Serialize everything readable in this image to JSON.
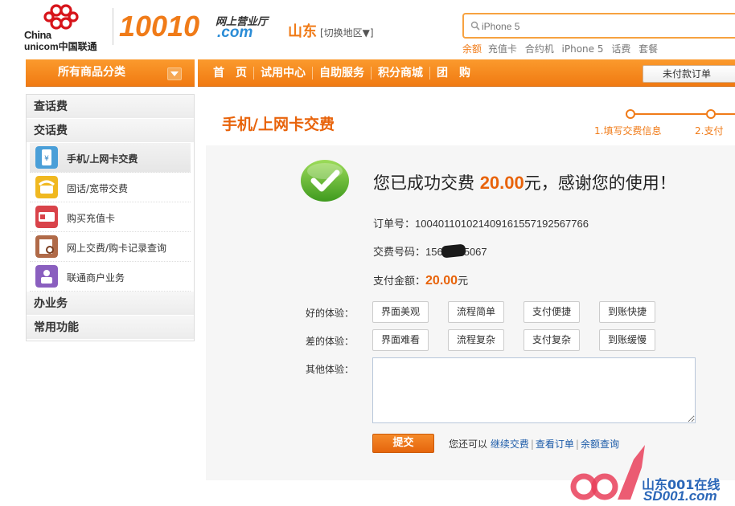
{
  "header": {
    "logo_line1": "China",
    "logo_line2": "unicom中国联通",
    "logo_number": "10010",
    "logo_wsyyt": "网上营业厅",
    "logo_com": ".com",
    "region": "山东",
    "region_switch": "[切换地区▼]",
    "search_placeholder": "iPhone 5",
    "hotwords": [
      "余额",
      "充值卡",
      "合约机",
      "iPhone 5",
      "话费",
      "套餐"
    ]
  },
  "nav": {
    "all_categories": "所有商品分类",
    "items": [
      "首　页",
      "试用中心",
      "自助服务",
      "积分商城",
      "团　购"
    ],
    "unpaid_orders": "未付款订单"
  },
  "sidebar": {
    "sections": {
      "query": "查话费",
      "pay": "交话费",
      "handle": "办业务",
      "common": "常用功能"
    },
    "items": [
      {
        "label": "手机/上网卡交费",
        "icon": "mobile-pay-icon"
      },
      {
        "label": "固话/宽带交费",
        "icon": "phone-icon"
      },
      {
        "label": "购买充值卡",
        "icon": "card-icon"
      },
      {
        "label": "网上交费/购卡记录查询",
        "icon": "record-search-icon"
      },
      {
        "label": "联通商户业务",
        "icon": "merchant-icon"
      }
    ]
  },
  "main": {
    "title": "手机/上网卡交费",
    "steps": [
      "1.填写交费信息",
      "2.支付"
    ],
    "success_prefix": "您已成功交费 ",
    "success_amount": "20.00",
    "success_suffix": "元，感谢您的使用！",
    "order_label": "订单号：",
    "order_no": "1004011010214091615571925 67766",
    "pay_number_label": "交费号码：",
    "pay_number_prefix": "156",
    "pay_number_suffix": "5067",
    "pay_amount_label": "支付金额：",
    "pay_amount": "20.00",
    "pay_amount_unit": "元",
    "good_label": "好的体验：",
    "good_tags": [
      "界面美观",
      "流程简单",
      "支付便捷",
      "到账快捷"
    ],
    "bad_label": "差的体验：",
    "bad_tags": [
      "界面难看",
      "流程复杂",
      "支付复杂",
      "到账缓慢"
    ],
    "other_label": "其他体验：",
    "submit": "提交",
    "after_text": "您还可以",
    "links": [
      "继续交费",
      "查看订单",
      "余额查询"
    ]
  },
  "watermark": {
    "line1": "山东001在线",
    "line2": "SD001.com"
  },
  "colors": {
    "accent": "#f07b18",
    "nav_bg": "#f58a20",
    "link": "#1a5aa8"
  }
}
